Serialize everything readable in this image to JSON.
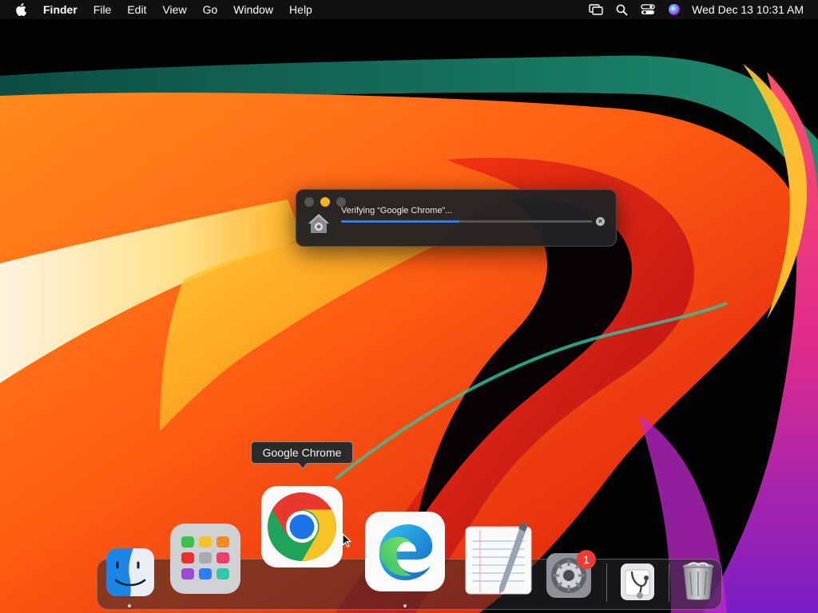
{
  "menubar": {
    "app_name": "Finder",
    "menus": [
      "File",
      "Edit",
      "View",
      "Go",
      "Window",
      "Help"
    ],
    "status_icons": [
      "screen-mirroring-icon",
      "search-icon",
      "control-center-icon",
      "siri-icon"
    ],
    "datetime": "Wed Dec 13  10:31 AM"
  },
  "dialog": {
    "title": "Verifying “Google Chrome”...",
    "progress": 0.47,
    "progress_color": "#2f7cf6",
    "icon": "home-folder-icon"
  },
  "tooltip": {
    "text": "Google Chrome"
  },
  "dock": {
    "apps": [
      {
        "name": "Finder",
        "icon": "finder-icon",
        "running": true
      },
      {
        "name": "Launchpad",
        "icon": "launchpad-icon",
        "running": false
      },
      {
        "name": "Google Chrome",
        "icon": "chrome-icon",
        "running": false
      },
      {
        "name": "Microsoft Edge",
        "icon": "edge-icon",
        "running": true
      },
      {
        "name": "TextEdit",
        "icon": "textedit-icon",
        "running": false
      },
      {
        "name": "System Preferences",
        "icon": "system-preferences-icon",
        "running": false,
        "badge": "1"
      },
      {
        "name": "Disk Utility",
        "icon": "disk-utility-icon",
        "running": false
      },
      {
        "name": "Trash",
        "icon": "trash-icon",
        "running": false
      }
    ]
  }
}
